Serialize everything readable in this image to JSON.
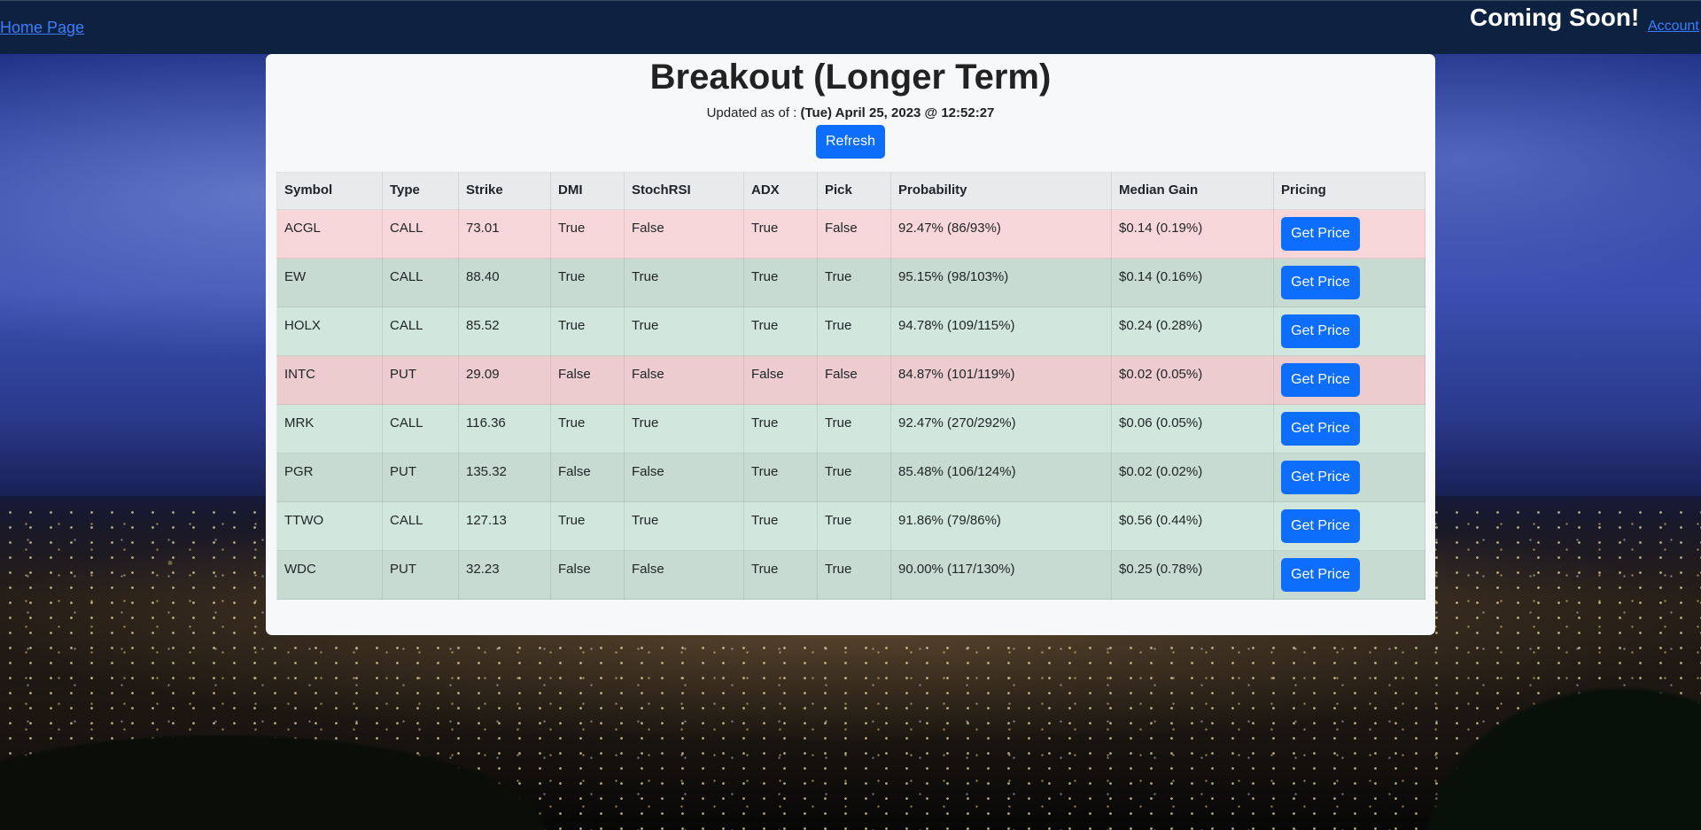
{
  "nav": {
    "home_link": "Home Page",
    "coming_soon": "Coming Soon!",
    "account_link": "Account"
  },
  "page": {
    "title": "Breakout (Longer Term)",
    "updated_label": "Updated as of : ",
    "updated_value": "(Tue) April 25, 2023 @ 12:52:27",
    "refresh_label": "Refresh"
  },
  "table": {
    "headers": [
      "Symbol",
      "Type",
      "Strike",
      "DMI",
      "StochRSI",
      "ADX",
      "Pick",
      "Probability",
      "Median Gain",
      "Pricing"
    ],
    "button_label": "Get Price",
    "rows": [
      {
        "symbol": "ACGL",
        "type": "CALL",
        "strike": "73.01",
        "dmi": "True",
        "stochrsi": "False",
        "adx": "True",
        "pick": "False",
        "probability": "92.47% (86/93%)",
        "median_gain": "$0.14 (0.19%)",
        "status": "red"
      },
      {
        "symbol": "EW",
        "type": "CALL",
        "strike": "88.40",
        "dmi": "True",
        "stochrsi": "True",
        "adx": "True",
        "pick": "True",
        "probability": "95.15% (98/103%)",
        "median_gain": "$0.14 (0.16%)",
        "status": "green"
      },
      {
        "symbol": "HOLX",
        "type": "CALL",
        "strike": "85.52",
        "dmi": "True",
        "stochrsi": "True",
        "adx": "True",
        "pick": "True",
        "probability": "94.78% (109/115%)",
        "median_gain": "$0.24 (0.28%)",
        "status": "green"
      },
      {
        "symbol": "INTC",
        "type": "PUT",
        "strike": "29.09",
        "dmi": "False",
        "stochrsi": "False",
        "adx": "False",
        "pick": "False",
        "probability": "84.87% (101/119%)",
        "median_gain": "$0.02 (0.05%)",
        "status": "red"
      },
      {
        "symbol": "MRK",
        "type": "CALL",
        "strike": "116.36",
        "dmi": "True",
        "stochrsi": "True",
        "adx": "True",
        "pick": "True",
        "probability": "92.47% (270/292%)",
        "median_gain": "$0.06 (0.05%)",
        "status": "green"
      },
      {
        "symbol": "PGR",
        "type": "PUT",
        "strike": "135.32",
        "dmi": "False",
        "stochrsi": "False",
        "adx": "True",
        "pick": "True",
        "probability": "85.48% (106/124%)",
        "median_gain": "$0.02 (0.02%)",
        "status": "green"
      },
      {
        "symbol": "TTWO",
        "type": "CALL",
        "strike": "127.13",
        "dmi": "True",
        "stochrsi": "True",
        "adx": "True",
        "pick": "True",
        "probability": "91.86% (79/86%)",
        "median_gain": "$0.56 (0.44%)",
        "status": "green"
      },
      {
        "symbol": "WDC",
        "type": "PUT",
        "strike": "32.23",
        "dmi": "False",
        "stochrsi": "False",
        "adx": "True",
        "pick": "True",
        "probability": "90.00% (117/130%)",
        "median_gain": "$0.25 (0.78%)",
        "status": "green"
      }
    ]
  },
  "colors": {
    "navbar": "#0c2240",
    "link": "#3d7dff",
    "button": "#0d6efd",
    "row_red": "#f8d7da",
    "row_green": "#d1e7dd",
    "card": "#f7f8fa"
  }
}
